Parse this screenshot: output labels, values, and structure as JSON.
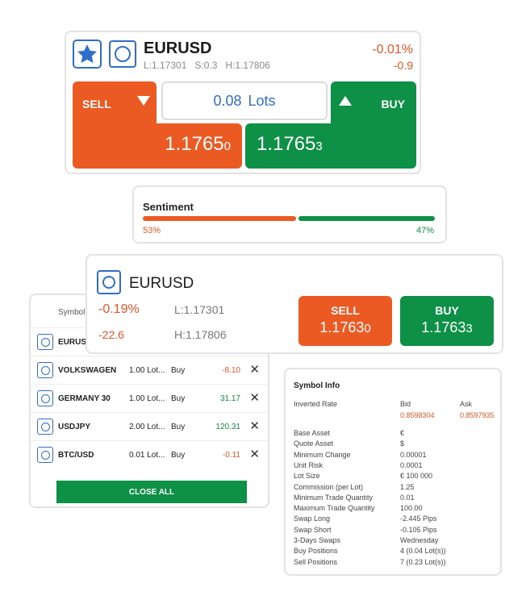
{
  "trade_card": {
    "symbol": "EURUSD",
    "low": "L:1.17301",
    "spread": "S:0.3",
    "high": "H:1.17806",
    "change_pct": "-0.01%",
    "change_pips": "-0.9",
    "sell_label": "SELL",
    "buy_label": "BUY",
    "lots_value": "0.08",
    "lots_unit": "Lots",
    "sell_price_main": "1.1765",
    "sell_price_pip": "0",
    "buy_price_main": "1.1765",
    "buy_price_pip": "3"
  },
  "sentiment": {
    "title": "Sentiment",
    "sell_pct": "53%",
    "buy_pct": "47%",
    "sell_fraction": 0.53
  },
  "positions": {
    "header": "Symbol",
    "rows": [
      {
        "symbol": "EURUSD",
        "lots": "",
        "side": "",
        "pnl": ""
      },
      {
        "symbol": "VOLKSWAGEN",
        "lots": "1.00 Lot...",
        "side": "Buy",
        "pnl": "-8.10",
        "pnl_color": "#ea5424"
      },
      {
        "symbol": "GERMANY 30",
        "lots": "1.00 Lot...",
        "side": "Buy",
        "pnl": "31.17",
        "pnl_color": "#0f9047"
      },
      {
        "symbol": "USDJPY",
        "lots": "2.00 Lot...",
        "side": "Buy",
        "pnl": "120.31",
        "pnl_color": "#0f9047"
      },
      {
        "symbol": "BTC/USD",
        "lots": "0.01 Lot...",
        "side": "Buy",
        "pnl": "-0.11",
        "pnl_color": "#ea5424"
      }
    ],
    "close_all_label": "CLOSE ALL"
  },
  "quote_card": {
    "symbol": "EURUSD",
    "change_pct": "-0.19%",
    "change_pips": "-22.6",
    "low": "L:1.17301",
    "high": "H:1.17806",
    "sell_label": "SELL",
    "sell_price_main": "1.1763",
    "sell_price_pip": "0",
    "buy_label": "BUY",
    "buy_price_main": "1.1763",
    "buy_price_pip": "3"
  },
  "symbol_info": {
    "title": "Symbol Info",
    "inverted_rate_label": "Inverted Rate",
    "bid_label": "Bid",
    "ask_label": "Ask",
    "bid_value": "0.8598304",
    "ask_value": "0.8597935",
    "rows": [
      {
        "key": "Base Asset",
        "value": "€"
      },
      {
        "key": "Quote Asset",
        "value": "$"
      },
      {
        "key": "Minimum Change",
        "value": "0.00001"
      },
      {
        "key": "Unit Risk",
        "value": "0.0001"
      },
      {
        "key": "Lot Size",
        "value": "€ 100 000"
      },
      {
        "key": "Commission (per Lot)",
        "value": "1.25"
      },
      {
        "key": "Minimum Trade Quantity",
        "value": "0.01"
      },
      {
        "key": "Maximum Trade Quantity",
        "value": "100.00"
      },
      {
        "key": "Swap Long",
        "value": "-2.445 Pips"
      },
      {
        "key": "Swap Short",
        "value": "-0.105 Pips"
      },
      {
        "key": "3-Days Swaps",
        "value": "Wednesday"
      },
      {
        "key": "Buy Positions",
        "value": "4 (0.04 Lot(s))"
      },
      {
        "key": "Sell Positions",
        "value": "7 (0.23 Lot(s))"
      }
    ]
  },
  "colors": {
    "sell": "#ec5a24",
    "buy": "#0f9047",
    "accent": "#2f6fc9"
  },
  "icons": [
    "star-icon",
    "symbol-icon",
    "triangle-down-icon",
    "triangle-up-icon",
    "close-icon"
  ]
}
